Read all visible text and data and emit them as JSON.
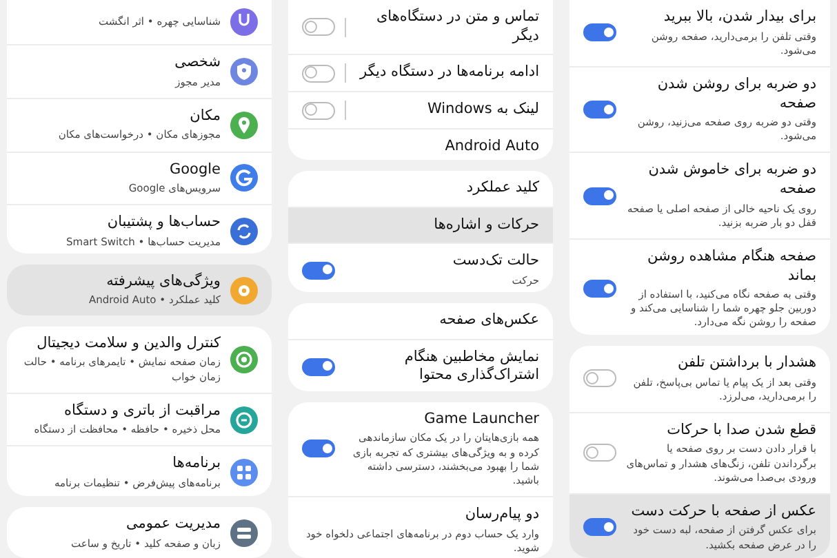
{
  "panels": [
    {
      "cards": [
        {
          "items": [
            {
              "kind": "toggle",
              "on": true,
              "title": "برای بیدار شدن، بالا ببرید",
              "subtitle": "وقتی تلفن را برمی‌دارید، صفحه روشن می‌شود.",
              "selected": false
            },
            {
              "kind": "toggle",
              "on": true,
              "title": "دو ضربه برای روشن شدن صفحه",
              "subtitle": "وقتی دو ضربه روی صفحه می‌زنید، روشن می‌شود.",
              "selected": false
            },
            {
              "kind": "toggle",
              "on": true,
              "title": "دو ضربه برای خاموش شدن صفحه",
              "subtitle": "روی یک ناحیه خالی از صفحه اصلی یا صفحه قفل دو بار ضربه بزنید.",
              "selected": false
            },
            {
              "kind": "toggle",
              "on": true,
              "title": "صفحه هنگام مشاهده روشن بماند",
              "subtitle": "وقتی به صفحه نگاه می‌کنید، با استفاده از دوربین جلو چهره شما را شناسایی می‌کند و صفحه را روشن نگه می‌دارد.",
              "selected": false
            }
          ]
        },
        {
          "items": [
            {
              "kind": "toggle",
              "on": false,
              "title": "هشدار با برداشتن تلفن",
              "subtitle": "وقتی بعد از یک پیام یا تماس بی‌پاسخ، تلفن را برمی‌دارید، می‌لرزد.",
              "selected": false
            },
            {
              "kind": "toggle",
              "on": false,
              "title": "قطع شدن صدا با حرکات",
              "subtitle": "با قرار دادن دست بر روی صفحه یا برگرداندن تلفن، زنگ‌های هشدار و تماس‌های ورودی بی‌صدا می‌شوند.",
              "selected": false
            },
            {
              "kind": "toggle",
              "on": true,
              "title": "عکس از صفحه با حرکت دست",
              "subtitle": "برای عکس گرفتن از صفحه، لبه دست خود را در عرض صفحه بکشید.",
              "selected": true
            }
          ]
        }
      ]
    },
    {
      "cards": [
        {
          "items": [
            {
              "kind": "split-toggle",
              "on": false,
              "title": "تماس و متن در دستگاه‌های دیگر",
              "selected": false
            },
            {
              "kind": "split-toggle",
              "on": false,
              "title": "ادامه برنامه‌ها در دستگاه دیگر",
              "selected": false
            },
            {
              "kind": "split-toggle",
              "on": false,
              "title": "لینک به Windows",
              "selected": false
            },
            {
              "kind": "plain",
              "title": "Android Auto",
              "selected": false
            }
          ]
        },
        {
          "items": [
            {
              "kind": "plain",
              "title": "کلید عملکرد",
              "selected": false
            },
            {
              "kind": "plain",
              "title": "حرکات و اشاره‌ها",
              "selected": true
            },
            {
              "kind": "toggle",
              "on": true,
              "title": "حالت تک‌دست",
              "subtitle": "حرکت",
              "selected": false
            }
          ]
        },
        {
          "items": [
            {
              "kind": "plain",
              "title": "عکس‌های صفحه",
              "selected": false
            },
            {
              "kind": "toggle",
              "on": true,
              "title": "نمایش مخاطبین هنگام اشتراک‌گذاری محتوا",
              "selected": false
            }
          ]
        },
        {
          "items": [
            {
              "kind": "toggle",
              "on": true,
              "title": "Game Launcher",
              "subtitle": "همه بازی‌هایتان را در یک مکان سازماندهی کرده و به ویژگی‌های بیشتری که تجربه بازی شما را بهبود می‌بخشند، دسترسی داشته باشید.",
              "selected": false
            },
            {
              "kind": "plain",
              "title": "دو پیام‌رسان",
              "subtitle": "وارد یک حساب دوم در برنامه‌های اجتماعی دلخواه خود شوید.",
              "selected": false
            }
          ]
        }
      ]
    },
    {
      "cards": [
        {
          "items": [
            {
              "kind": "icon",
              "color": "#7b6ee6",
              "subtitle": "شناسایی چهره • اثر انگشت",
              "selected": false
            },
            {
              "kind": "icon",
              "color": "#6f86e0",
              "title": "شخصی",
              "subtitle": "مدیر مجوز",
              "selected": false
            },
            {
              "kind": "icon",
              "color": "#4caf50",
              "title": "مکان",
              "subtitle": "مجوزهای مکان • درخواست‌های مکان",
              "selected": false
            },
            {
              "kind": "icon",
              "color": "#3f7de8",
              "title": "Google",
              "subtitle": "سرویس‌های Google",
              "selected": false
            },
            {
              "kind": "icon",
              "color": "#3a6fd8",
              "title": "حساب‌ها و پشتیبان",
              "subtitle": "مدیریت حساب‌ها • Smart Switch",
              "selected": false
            }
          ]
        },
        {
          "items": [
            {
              "kind": "icon",
              "color": "#f0a830",
              "title": "ویژگی‌های پیشرفته",
              "subtitle": "کلید عملکرد • Android Auto",
              "selected": true
            }
          ]
        },
        {
          "items": [
            {
              "kind": "icon",
              "color": "#4caf50",
              "title": "کنترل والدین و سلامت دیجیتال",
              "subtitle": "زمان صفحه نمایش • تایمرهای برنامه • حالت زمان خواب",
              "selected": false
            },
            {
              "kind": "icon",
              "color": "#26a69a",
              "title": "مراقبت از باتری و دستگاه",
              "subtitle": "محل ذخیره • حافظه • محافظت از دستگاه",
              "selected": false
            },
            {
              "kind": "icon",
              "color": "#5b8def",
              "title": "برنامه‌ها",
              "subtitle": "برنامه‌های پیش‌فرض • تنظیمات برنامه",
              "selected": false
            }
          ]
        },
        {
          "items": [
            {
              "kind": "icon",
              "color": "#5f7185",
              "title": "مدیریت عمومی",
              "subtitle": "زبان و صفحه کلید • تاریخ و ساعت",
              "selected": false
            }
          ]
        }
      ]
    }
  ]
}
